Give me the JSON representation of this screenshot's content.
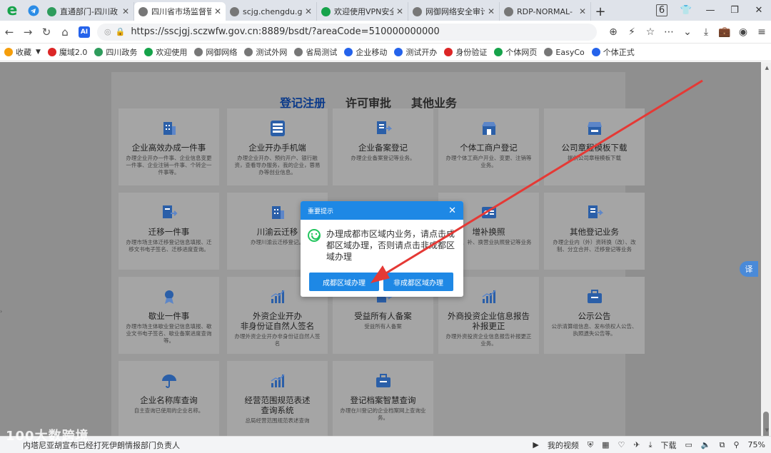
{
  "tabs": [
    {
      "label": "直通部门-四川政",
      "color": "#2e9c5c",
      "active": false
    },
    {
      "label": "四川省市场监督管",
      "color": "#777777",
      "active": true
    },
    {
      "label": "scjg.chengdu.g",
      "color": "#777777",
      "active": false
    },
    {
      "label": "欢迎使用VPN安全",
      "color": "#16a34a",
      "active": false
    },
    {
      "label": "网御网络安全审计",
      "color": "#777777",
      "active": false
    },
    {
      "label": "RDP-NORMAL-",
      "color": "#777777",
      "active": false
    }
  ],
  "tab_count": "6",
  "url": "https://sscjgj.sczwfw.gov.cn:8889/bsdt/?areaCode=510000000000",
  "bookmarks": [
    {
      "label": "收藏",
      "color": "#f59e0b"
    },
    {
      "label": "魔域2.0",
      "color": "#dc2626"
    },
    {
      "label": "四川政务",
      "color": "#2e9c5c"
    },
    {
      "label": "欢迎使用",
      "color": "#16a34a"
    },
    {
      "label": "网御网络",
      "color": "#777777"
    },
    {
      "label": "测试外网",
      "color": "#777777"
    },
    {
      "label": "省局测试",
      "color": "#777777"
    },
    {
      "label": "企业移动",
      "color": "#2563eb"
    },
    {
      "label": "测试开办",
      "color": "#2563eb"
    },
    {
      "label": "身份验证",
      "color": "#dc2626"
    },
    {
      "label": "个体网页",
      "color": "#16a34a"
    },
    {
      "label": "EasyCo",
      "color": "#777777"
    },
    {
      "label": "个体正式",
      "color": "#2563eb"
    }
  ],
  "page": {
    "nav": [
      "登记注册",
      "许可审批",
      "其他业务"
    ],
    "cards": [
      {
        "title": "企业高效办成一件事",
        "desc": "办理企业开办一件事、企业信息变更一件事、企业注销一件事、个转企一件事等。",
        "icon": "building-icon"
      },
      {
        "title": "企业开办手机端",
        "desc": "办理企业开办、预约开户、银行融资，查看导办服务，我的企业，蓉易办等创业信息。",
        "icon": "mobile-app-icon"
      },
      {
        "title": "企业备案登记",
        "desc": "办理企业备案登记等业务。",
        "icon": "doc-register-icon"
      },
      {
        "title": "个体工商户登记",
        "desc": "办理个体工商户开业、变更、注销等业务。",
        "icon": "shop-icon"
      },
      {
        "title": "公司章程模板下载",
        "desc": "提供公司章程模板下载",
        "icon": "store-icon"
      },
      {
        "title": "迁移一件事",
        "desc": "办理市场主体迁移登记信息填报、迁移文书电子签名、迁移进度查询。",
        "icon": "migrate-icon"
      },
      {
        "title": "川渝云迁移",
        "desc": "办理川渝云迁移登记。",
        "icon": "building-icon"
      },
      {
        "title": "",
        "desc": "",
        "icon": ""
      },
      {
        "title": "增补换照",
        "desc": "办理增、补、换营业执照登记等业务",
        "icon": "license-icon"
      },
      {
        "title": "其他登记业务",
        "desc": "办理企业内（外）资转换（改）、改制、分立合并、迁移登记等业务",
        "icon": "doc-register-icon"
      },
      {
        "title": "歇业一件事",
        "desc": "办理市场主体歇业登记信息填报、歇业文书电子签名、歇业备案进度查询等。",
        "icon": "medal-icon"
      },
      {
        "title": "外资企业开办\n非身份证自然人签名",
        "desc": "办理外资企业开办非身份证自然人签名",
        "icon": "chart-icon"
      },
      {
        "title": "受益所有人备案",
        "desc": "受益所有人备案",
        "icon": "doc-register-icon"
      },
      {
        "title": "外商投资企业信息报告\n补报更正",
        "desc": "办理外资投资企业信息报告补报更正业务。",
        "icon": "chart-icon"
      },
      {
        "title": "公示公告",
        "desc": "公示清算组信息、发布债权人公告、执照遗失公告等。",
        "icon": "briefcase-icon"
      },
      {
        "title": "企业名称库查询",
        "desc": "自主查询已使用的企业名称。",
        "icon": "umbrella-icon"
      },
      {
        "title": "经营范围规范表述\n查询系统",
        "desc": "总局经营范围规范表述查询",
        "icon": "chart-icon"
      },
      {
        "title": "登记档案智慧查询",
        "desc": "办理在川登记的企业档案网上查询业务。",
        "icon": "briefcase-icon"
      }
    ]
  },
  "modal": {
    "header": "重要提示",
    "message": "办理成都市区域内业务，请点击成都区域办理，否则请点击非成都区域办理",
    "btn_chengdu": "成都区域办理",
    "btn_non_chengdu": "非成都区域办理"
  },
  "translate_label": "译",
  "status": {
    "ticker": "内塔尼亚胡宣布已经打死伊朗情报部门负责人",
    "video": "我的视频",
    "download": "下载",
    "zoom": "75%"
  },
  "watermark": "100大数跨境",
  "accent": "#1e88e5"
}
